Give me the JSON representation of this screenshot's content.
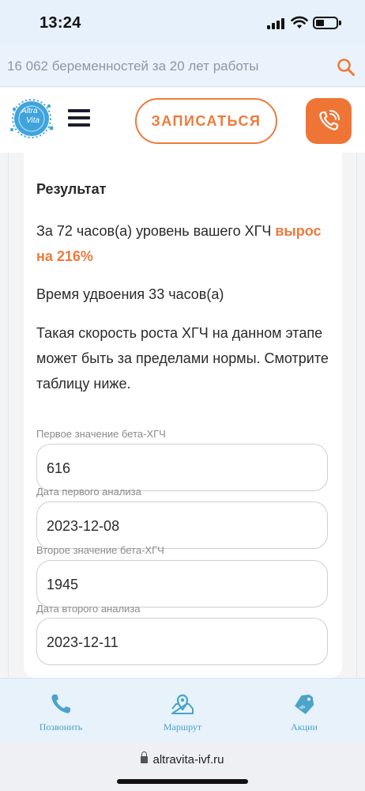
{
  "status_bar": {
    "time": "13:24"
  },
  "info_strip": {
    "text": "16 062 беременностей за 20 лет работы"
  },
  "header": {
    "logo_line1": "Altra",
    "logo_line2": "Vita",
    "signup_label": "ЗАПИСАТЬСЯ"
  },
  "result": {
    "title": "Результат",
    "p1_text": "За 72 часов(а) уровень вашего ХГЧ ",
    "p1_highlight": "вырос на 216%",
    "p2_text": "Время удвоения 33 часов(а)",
    "p3_text": "Такая скорость роста ХГЧ на данном этапе может быть за пределами нормы. Смотрите таблицу ниже."
  },
  "form": {
    "fields": [
      {
        "label": "Первое значение бета-ХГЧ",
        "value": "616"
      },
      {
        "label": "Дата первого анализа",
        "value": "2023-12-08"
      },
      {
        "label": "Второе значение бета-ХГЧ",
        "value": "1945"
      },
      {
        "label": "Дата второго анализа",
        "value": "2023-12-11"
      }
    ]
  },
  "bottom_nav": {
    "items": [
      {
        "label": "Позвонить",
        "icon": "phone-icon"
      },
      {
        "label": "Маршрут",
        "icon": "map-pin-icon"
      },
      {
        "label": "Акции",
        "icon": "tag-icon"
      }
    ]
  },
  "browser": {
    "url": "altravita-ivf.ru"
  },
  "colors": {
    "accent": "#ee7a3b",
    "nav_icon": "#4aa3c9",
    "strip_bg": "#eaf3fb"
  }
}
